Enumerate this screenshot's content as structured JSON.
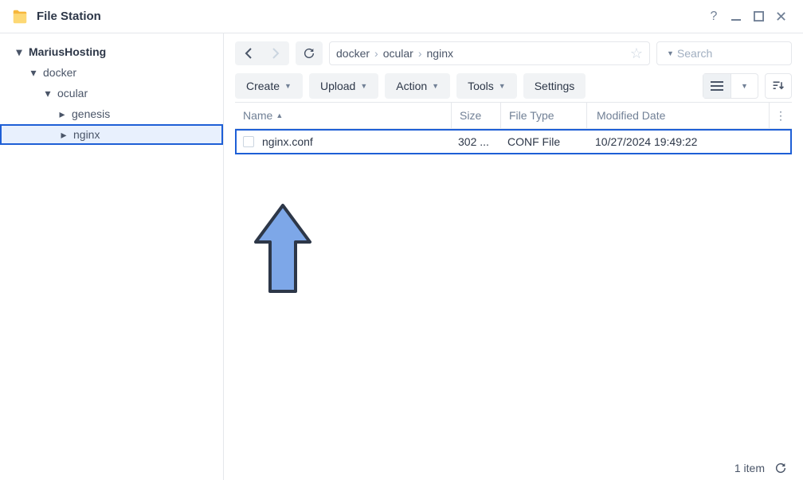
{
  "app": {
    "title": "File Station"
  },
  "tree": {
    "root": "MariusHosting",
    "level1": "docker",
    "level2": "ocular",
    "level3a": "genesis",
    "level3b": "nginx"
  },
  "breadcrumb": {
    "seg1": "docker",
    "seg2": "ocular",
    "seg3": "nginx"
  },
  "search": {
    "placeholder": "Search"
  },
  "toolbar": {
    "create": "Create",
    "upload": "Upload",
    "action": "Action",
    "tools": "Tools",
    "settings": "Settings"
  },
  "columns": {
    "name": "Name",
    "size": "Size",
    "type": "File Type",
    "date": "Modified Date"
  },
  "files": [
    {
      "name": "nginx.conf",
      "size": "302 ...",
      "type": "CONF File",
      "date": "10/27/2024 19:49:22"
    }
  ],
  "status": {
    "count": "1 item"
  }
}
